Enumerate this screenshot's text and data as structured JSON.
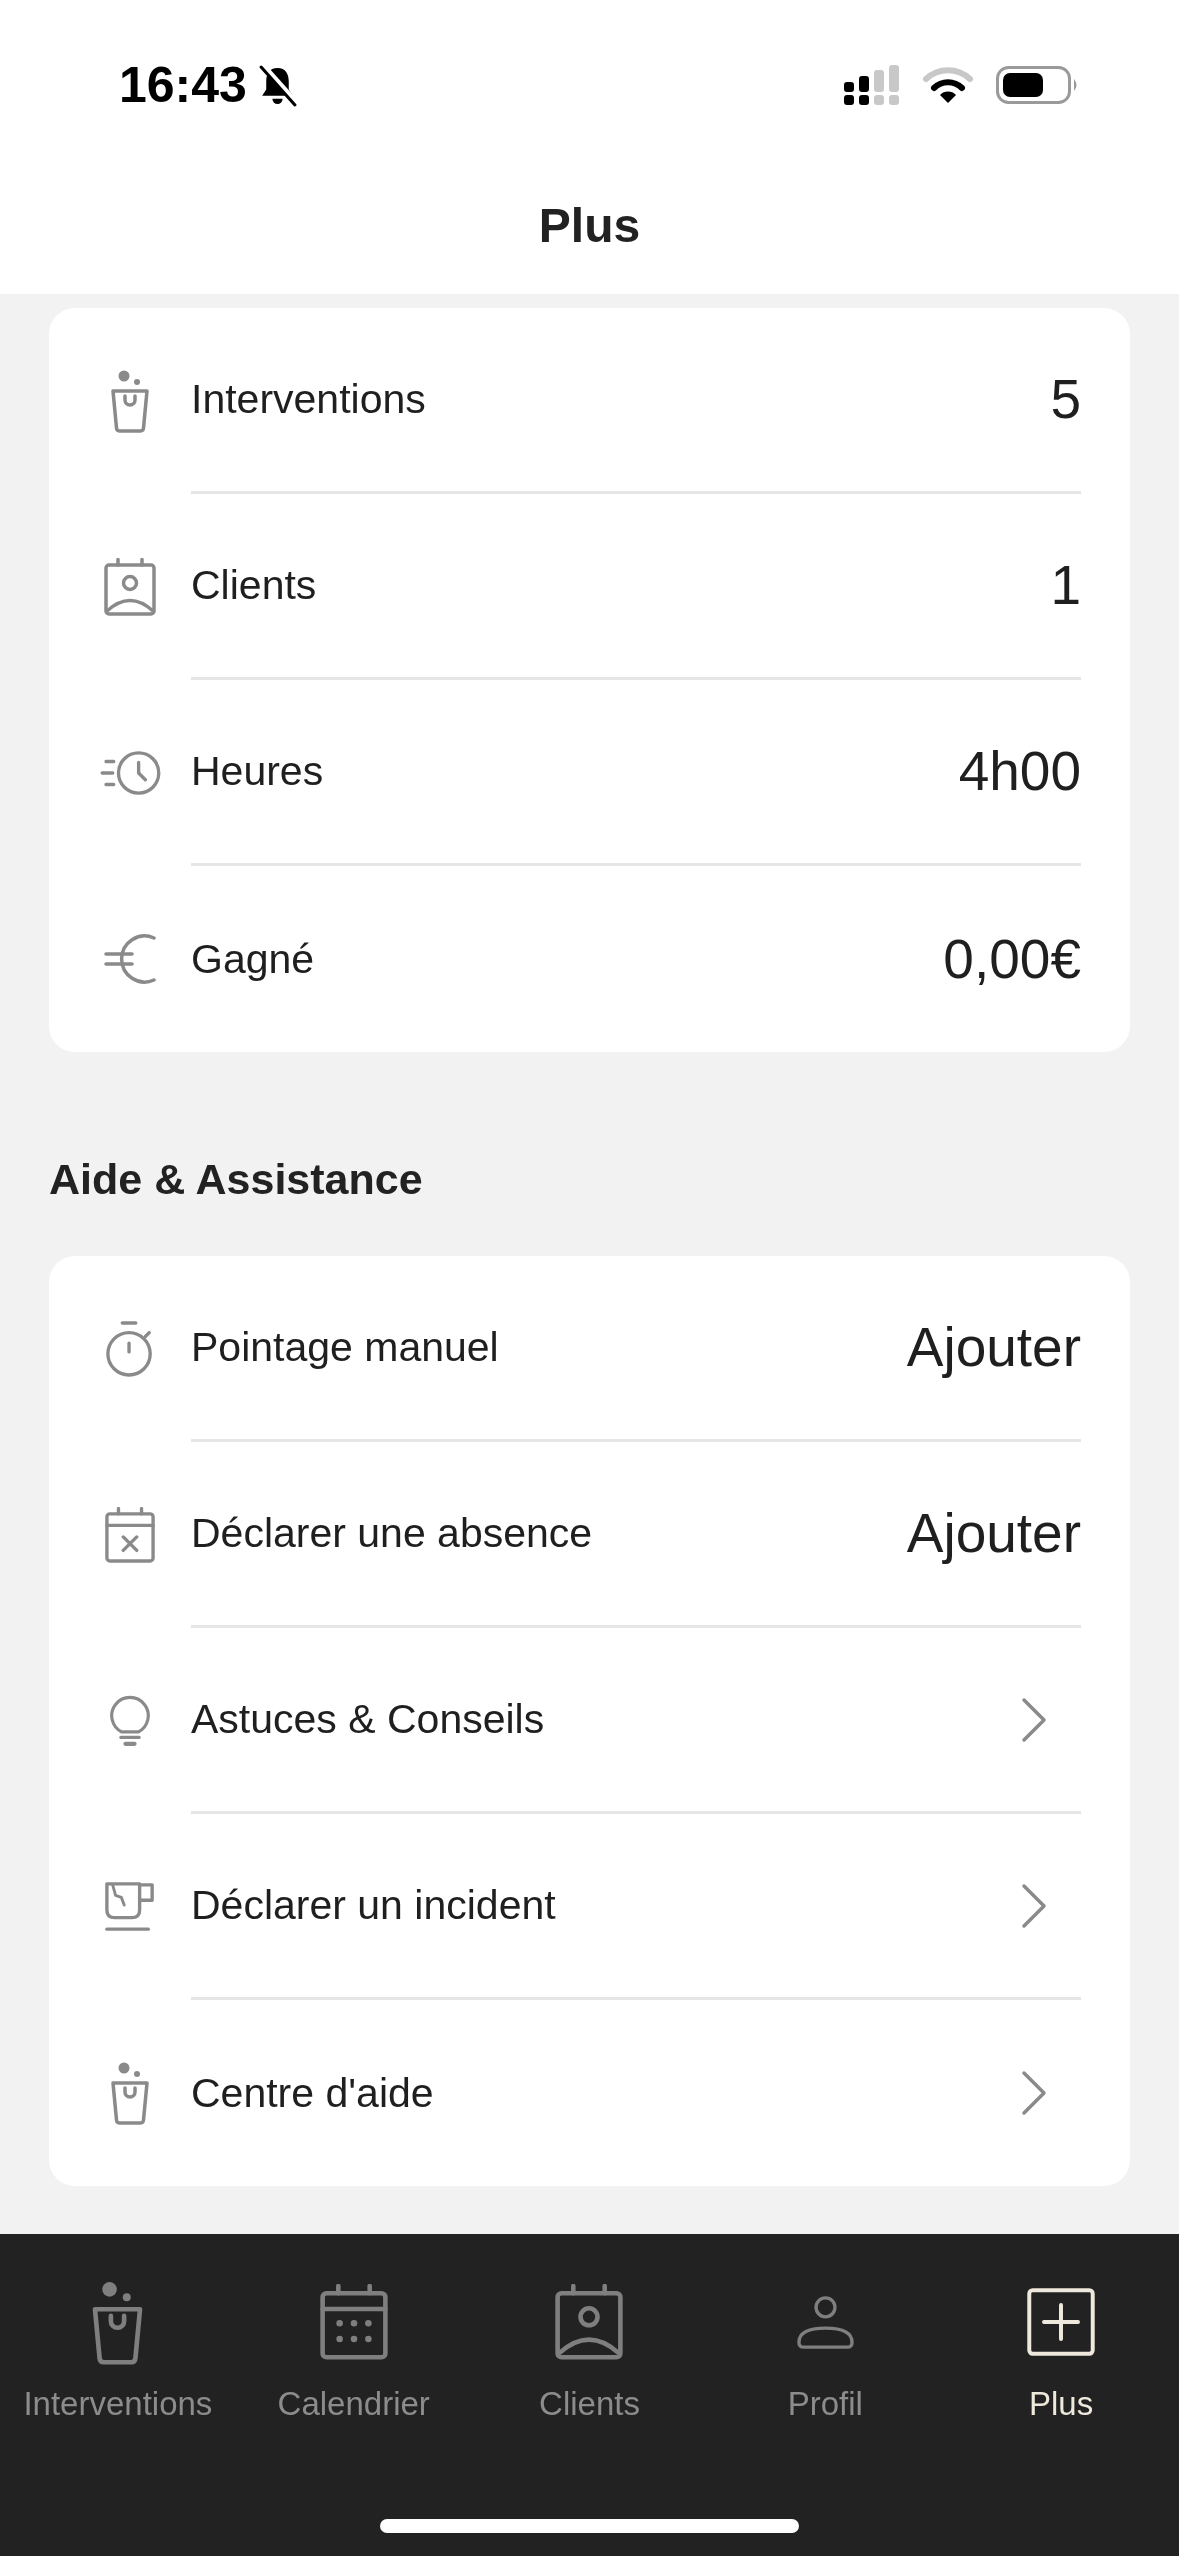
{
  "status_bar": {
    "time": "16:43"
  },
  "header": {
    "title": "Plus"
  },
  "stats": [
    {
      "label": "Interventions",
      "value": "5"
    },
    {
      "label": "Clients",
      "value": "1"
    },
    {
      "label": "Heures",
      "value": "4h00"
    },
    {
      "label": "Gagné",
      "value": "0,00€"
    }
  ],
  "help": {
    "title": "Aide & Assistance",
    "items": [
      {
        "kind": "action",
        "label": "Pointage manuel",
        "button": "Ajouter"
      },
      {
        "kind": "action",
        "label": "Déclarer une absence",
        "button": "Ajouter"
      },
      {
        "kind": "link",
        "label": "Astuces & Conseils"
      },
      {
        "kind": "link",
        "label": "Déclarer un incident"
      },
      {
        "kind": "link",
        "label": "Centre d'aide"
      }
    ]
  },
  "tab_bar": [
    {
      "label": "Interventions",
      "selected": false
    },
    {
      "label": "Calendrier",
      "selected": false
    },
    {
      "label": "Clients",
      "selected": false
    },
    {
      "label": "Profil",
      "selected": false
    },
    {
      "label": "Plus",
      "selected": true
    }
  ]
}
